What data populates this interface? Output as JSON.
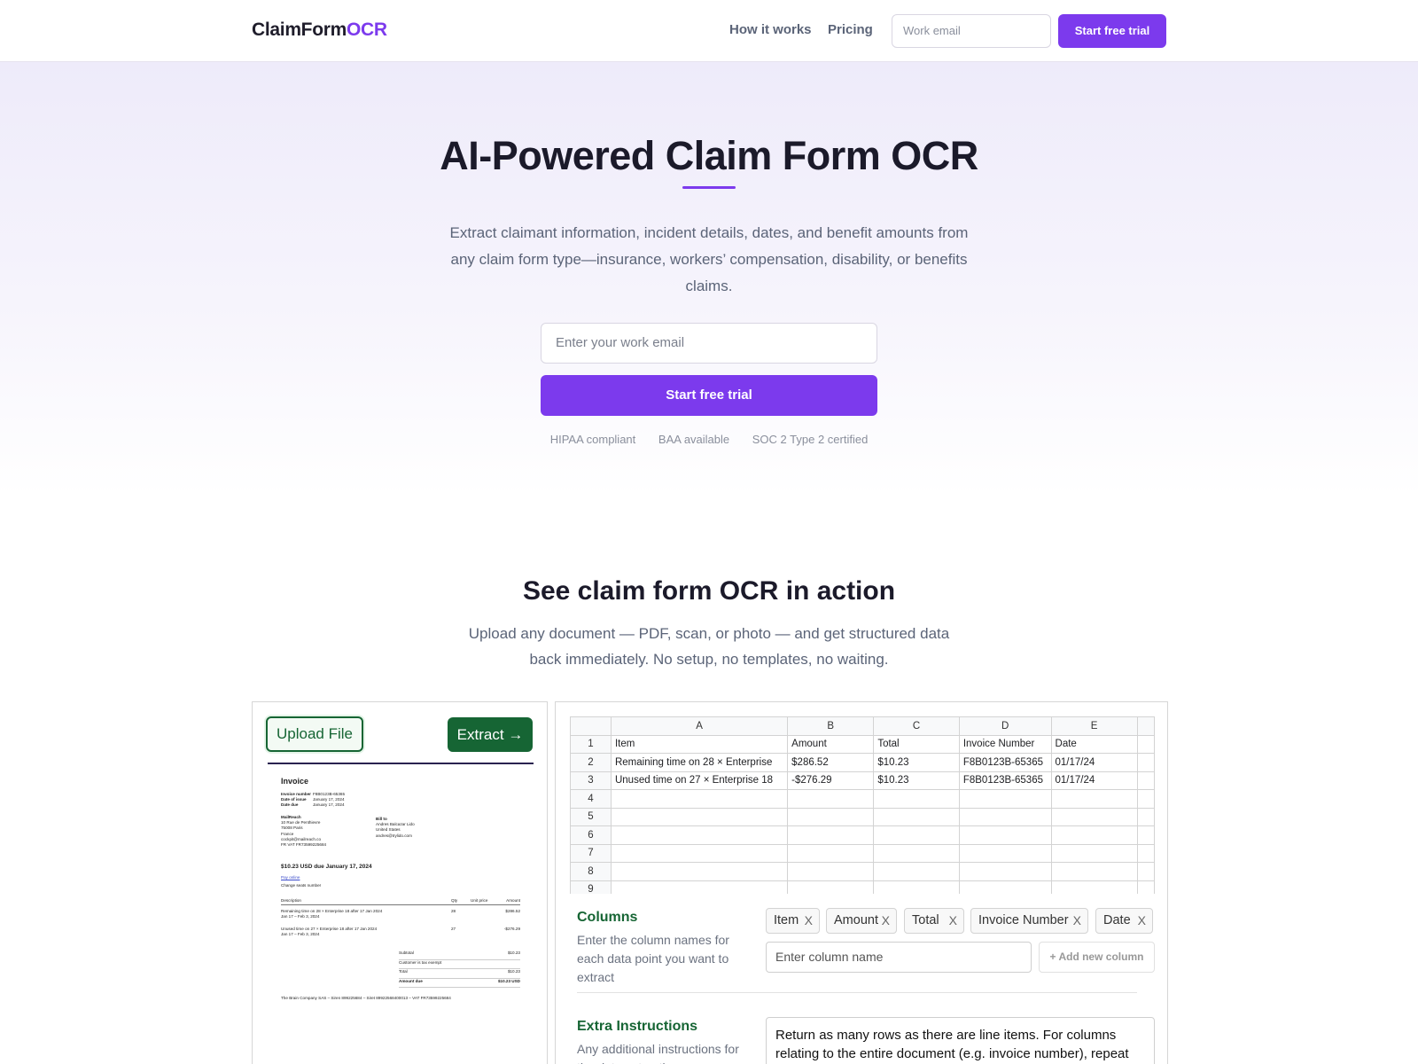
{
  "header": {
    "logo_main": "ClaimForm",
    "logo_accent": "OCR",
    "nav": [
      {
        "label": "How it works"
      },
      {
        "label": "Pricing"
      }
    ],
    "email_placeholder": "Work email",
    "cta": "Start free trial"
  },
  "hero": {
    "title": "AI-Powered Claim Form OCR",
    "subtitle": "Extract claimant information, incident details, dates, and benefit amounts from any claim form type—insurance, workers’ compensation, disability, or benefits claims.",
    "email_placeholder": "Enter your work email",
    "cta": "Start free trial",
    "badges": [
      "HIPAA compliant",
      "BAA available",
      "SOC 2 Type 2 certified"
    ]
  },
  "demo": {
    "title": "See claim form OCR in action",
    "subtitle": "Upload any document — PDF, scan, or photo — and get structured data back immediately. No setup, no templates, no waiting.",
    "upload_label": "Upload File",
    "extract_label": "Extract",
    "extract_icon": "arrow-right-icon",
    "invoice": {
      "title": "Invoice",
      "meta": [
        {
          "k": "Invoice number",
          "v": "F8B0123B-65365"
        },
        {
          "k": "Date of issue",
          "v": "January 17, 2024"
        },
        {
          "k": "Date due",
          "v": "January 17, 2024"
        }
      ],
      "from": [
        "MailReach",
        "10 Rue de Penthievre",
        "75008 Paris",
        "France",
        "cockpit@mailreach.co",
        "FR VAT FR73599225684"
      ],
      "to": [
        "Bill to",
        "Andres Balcazar Lido",
        "United States",
        "andres@trylido.com"
      ],
      "due": "$10.23 USD due January 17, 2024",
      "pay": "Pay online",
      "change": "Change seats number",
      "table_headers": [
        "Description",
        "Qty",
        "Unit price",
        "Amount"
      ],
      "lines": [
        {
          "desc": "Remaining time on 28 × Enterprise 18 after 17 Jan 2024",
          "period": "Jan 17 – Feb 3, 2024",
          "qty": "28",
          "amount": "$286.52"
        },
        {
          "desc": "Unused time on 27 × Enterprise 18 after 17 Jan 2024",
          "period": "Jan 17 – Feb 3, 2024",
          "qty": "27",
          "amount": "-$276.29"
        }
      ],
      "summary": [
        {
          "k": "Subtotal",
          "v": "$10.23"
        },
        {
          "k": "Customer is tax exempt",
          "v": ""
        },
        {
          "k": "Total",
          "v": "$10.23"
        },
        {
          "k": "Amount due",
          "v": "$10.23 USD"
        }
      ],
      "footer": "The Brain Company SAS – Siren 899225684 – Siret 89922568400013 – VAT FR73599225684"
    },
    "sheet": {
      "col_letters": [
        "A",
        "B",
        "C",
        "D",
        "E"
      ],
      "rows": [
        {
          "n": "1",
          "cells": [
            "Item",
            "Amount",
            "Total",
            "Invoice Number",
            "Date"
          ]
        },
        {
          "n": "2",
          "cells": [
            "Remaining time on 28 × Enterprise",
            "$286.52",
            "$10.23",
            "F8B0123B-65365",
            "01/17/24"
          ]
        },
        {
          "n": "3",
          "cells": [
            "Unused time on 27 × Enterprise 18",
            "-$276.29",
            "$10.23",
            "F8B0123B-65365",
            "01/17/24"
          ]
        },
        {
          "n": "4",
          "cells": [
            "",
            "",
            "",
            "",
            ""
          ]
        },
        {
          "n": "5",
          "cells": [
            "",
            "",
            "",
            "",
            ""
          ]
        },
        {
          "n": "6",
          "cells": [
            "",
            "",
            "",
            "",
            ""
          ]
        },
        {
          "n": "7",
          "cells": [
            "",
            "",
            "",
            "",
            ""
          ]
        },
        {
          "n": "8",
          "cells": [
            "",
            "",
            "",
            "",
            ""
          ]
        },
        {
          "n": "9",
          "cells": [
            "",
            "",
            "",
            "",
            ""
          ]
        }
      ]
    },
    "columns": {
      "title": "Columns",
      "description": "Enter the column names for each data point you want to extract",
      "chips": [
        {
          "label": "Item"
        },
        {
          "label": "Amount"
        },
        {
          "label": "Total"
        },
        {
          "label": "Invoice Number"
        },
        {
          "label": "Date"
        }
      ],
      "chip_remove_glyph": "X",
      "input_placeholder": "Enter column name",
      "add_label": "+ Add new column"
    },
    "extra": {
      "title": "Extra Instructions",
      "description": "Any additional instructions for the data extraction",
      "value": "Return as many rows as there are line items. For columns relating to the entire document (e.g. invoice number), repeat the value for each row. Return dates in format"
    }
  }
}
